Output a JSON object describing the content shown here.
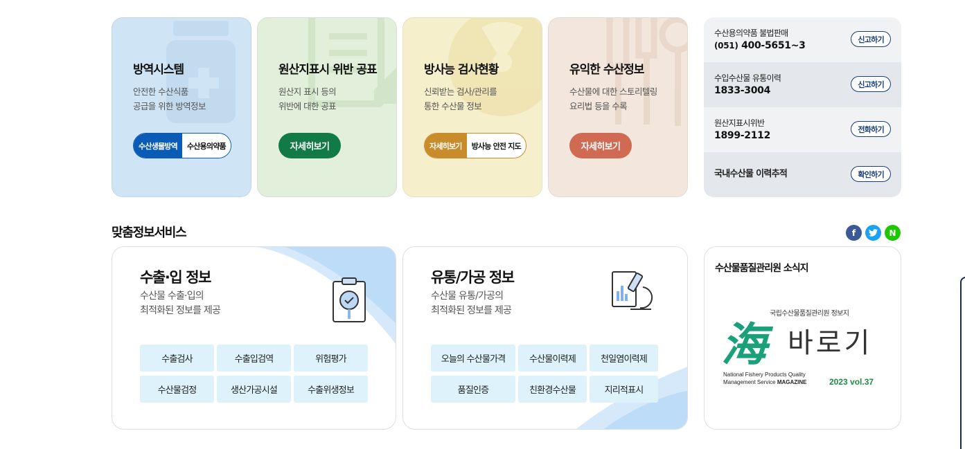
{
  "cards": [
    {
      "title": "방역시스템",
      "desc": [
        "안전한 수산식품",
        "공급을 위한 방역정보"
      ],
      "buttons": [
        "수산생물방역",
        "수산용의약품"
      ],
      "color": "#0a5bb5"
    },
    {
      "title": "원산지표시 위반 공표",
      "desc": [
        "원산지 표시 등의",
        "위반에 대한 공표"
      ],
      "button": "자세히보기",
      "color": "#127a47"
    },
    {
      "title": "방사능 검사현황",
      "desc": [
        "신뢰받는 검사/관리를",
        "통한 수산물 정보"
      ],
      "buttons": [
        "자세히보기",
        "방사능 안전 지도"
      ],
      "color": "#c98c2a"
    },
    {
      "title": "유익한 수산정보",
      "desc": [
        "수산물에 대한 스토리텔링",
        "요리법 등을 수록"
      ],
      "button": "자세히보기",
      "color": "#d06a52"
    }
  ],
  "contacts": [
    {
      "label": "수산용의약품 불법판매",
      "prefix": "(051)",
      "phone": "400-5651~3",
      "action": "신고하기"
    },
    {
      "label": "수입수산물 유통이력",
      "prefix": "",
      "phone": "1833-3004",
      "action": "신고하기"
    },
    {
      "label": "원산지표시위반",
      "prefix": "",
      "phone": "1899-2112",
      "action": "전화하기"
    },
    {
      "label": "국내수산물 이력추적",
      "prefix": "",
      "phone": "",
      "action": "확인하기"
    }
  ],
  "section_title": "맞춤정보서비스",
  "sns": [
    {
      "icon": "facebook-icon",
      "glyph": "f",
      "color": "#3b5998"
    },
    {
      "icon": "twitter-icon",
      "glyph": "t",
      "color": "#1da1f2"
    },
    {
      "icon": "naver-icon",
      "glyph": "N",
      "color": "#1ec800"
    }
  ],
  "services": [
    {
      "title": "수출·입 정보",
      "desc": [
        "수산물 수출·입의",
        "최적화된 정보를 제공"
      ],
      "items": [
        "수출검사",
        "수출입검역",
        "위험평가",
        "수산물검정",
        "생산가공시설",
        "수출위생정보"
      ]
    },
    {
      "title": "유통/가공 정보",
      "desc": [
        "수산물 유통/가공의",
        "최적화된 정보를 제공"
      ],
      "items": [
        "오늘의 수산물가격",
        "수산물이력제",
        "천일염이력제",
        "품질인증",
        "친환경수산물",
        "지리적표시"
      ]
    }
  ],
  "news": {
    "title": "수산물품질관리원 소식지",
    "mag_sub": "국립수산물품질관리원 정보지",
    "mag_logo_a": "海",
    "mag_logo_b": "바로기",
    "mag_en_1": "National Fishery Products Quality",
    "mag_en_2": "Management Service",
    "mag_en_3": "MAGAZINE",
    "mag_vol": "2023 vol.37"
  }
}
